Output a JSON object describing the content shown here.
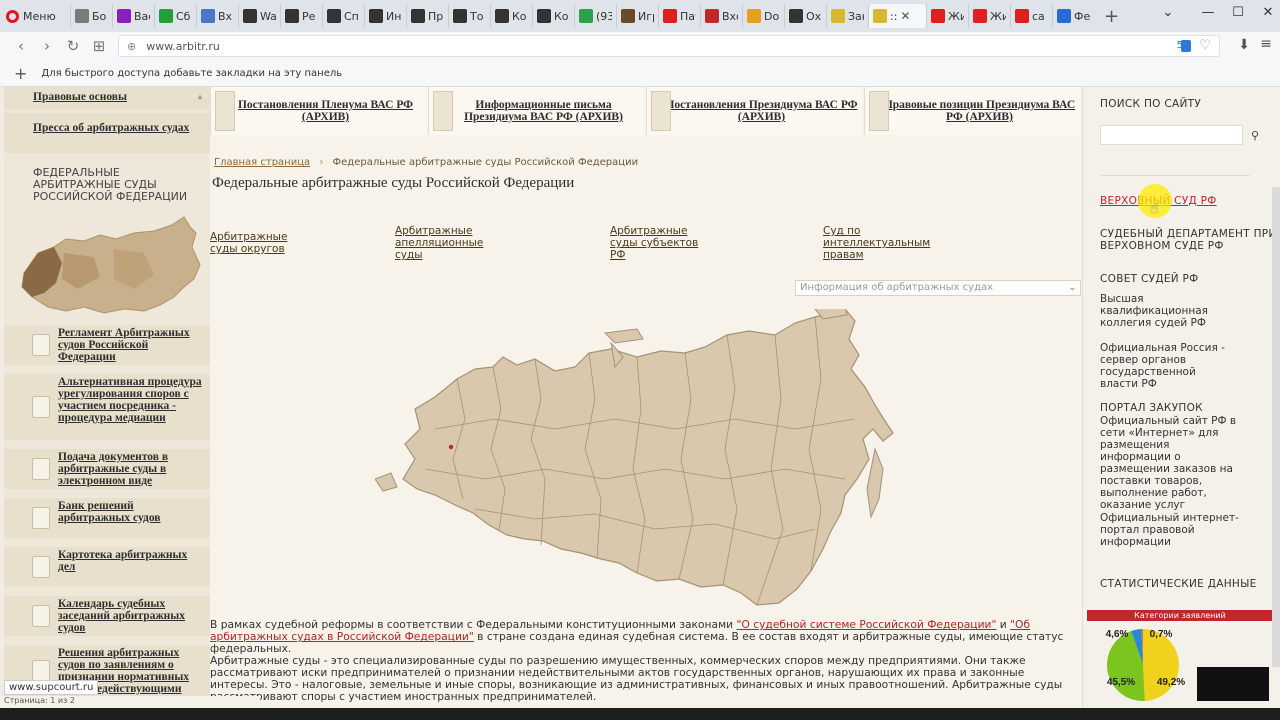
{
  "browser": {
    "menu_label": "Меню",
    "tabs": [
      {
        "label": "Бо",
        "color": "#7a7a7a"
      },
      {
        "label": "Вас",
        "color": "#8b1ebe"
      },
      {
        "label": "Сб",
        "color": "#21a038"
      },
      {
        "label": "Вх",
        "color": "#4a78c8"
      },
      {
        "label": "Wa",
        "color": "#333333"
      },
      {
        "label": "Ре",
        "color": "#333333"
      },
      {
        "label": "Сп",
        "color": "#333333"
      },
      {
        "label": "Ин",
        "color": "#333333"
      },
      {
        "label": "Пр",
        "color": "#333333"
      },
      {
        "label": "То",
        "color": "#333333"
      },
      {
        "label": "Ко",
        "color": "#333333"
      },
      {
        "label": "Ко",
        "color": "#333333"
      },
      {
        "label": "(93",
        "color": "#2aa14b"
      },
      {
        "label": "Игр",
        "color": "#6b4a2a"
      },
      {
        "label": "Пач",
        "color": "#e02020"
      },
      {
        "label": "Вхо",
        "color": "#c0262a"
      },
      {
        "label": "Do",
        "color": "#e8a020"
      },
      {
        "label": "Ох",
        "color": "#333333"
      },
      {
        "label": "Зак",
        "color": "#d8b830"
      }
    ],
    "active_tab": {
      "label": "::",
      "close": "✕",
      "color": "#d8b830"
    },
    "tabs_after": [
      {
        "label": "Жи",
        "color": "#e02020"
      },
      {
        "label": "Жи",
        "color": "#e02020"
      },
      {
        "label": "са",
        "color": "#e02020"
      },
      {
        "label": "Фе",
        "color": "#2a6ad6"
      }
    ],
    "url": "www.arbitr.ru",
    "counter": "5",
    "bookmarks_hint": "Для быстрого доступа добавьте закладки на эту панель"
  },
  "left_nav": {
    "top_items": [
      "Правовые основы",
      "Пресса об арбитражных судах"
    ],
    "fed_label": "ФЕДЕРАЛЬНЫЕ АРБИТРАЖНЫЕ СУДЫ РОССИЙСКОЙ ФЕДЕРАЦИИ",
    "doc_items": [
      "Регламент Арбитражных судов Российской Федерации",
      "Альтернативная процедура урегулирования споров с участием посредника - процедура медиации",
      "Подача документов в арбитражные суды в электронном виде",
      "Банк решений арбитражных судов",
      "Картотека арбитражных дел",
      "Календарь судебных заседаний арбитражных судов",
      "Решения арбитражных судов по заявлениям о признании нормативных актов недействующими"
    ]
  },
  "top_docs": [
    "Постановления Пленума ВАС РФ (АРХИВ)",
    "Информационные письма Президиума ВАС РФ (АРХИВ)",
    "Постановления Президиума ВАС РФ (АРХИВ)",
    "Правовые позиции Президиума ВАС РФ (АРХИВ)"
  ],
  "breadcrumb": {
    "home": "Главная страница",
    "separator": "›",
    "current": "Федеральные арбитражные суды Российской Федерации"
  },
  "page_title": "Федеральные арбитражные суды Российской Федерации",
  "court_links": [
    "Арбитражные суды округов",
    "Арбитражные апелляционные суды",
    "Арбитражные суды субъектов РФ",
    "Суд по интеллектуальным правам"
  ],
  "info_select": {
    "value": "Информация об арбитражных судах",
    "arrow": "⌄"
  },
  "paragraph1": {
    "before": "В рамках судебной реформы в соответствии с Федеральными конституционными законами ",
    "link1": "\"О судебной системе Российской Федерации\"",
    "middle": " и ",
    "link2": "\"Об арбитражных судах в Российской Федерации\"",
    "after": " в стране создана единая судебная система. В ее состав входят и арбитражные суды, имеющие статус федеральных."
  },
  "paragraph2": "Арбитражные суды - это специализированные суды по разрешению имущественных, коммерческих споров между предприятиями. Они также рассматривают иски предпринимателей о признании недействительными актов государственных органов, нарушающих их права и законные интересы. Это - налоговые, земельные и иные споры, возникающие из административных, финансовых и иных правоотношений. Арбитражные суды рассматривают споры с участием иностранных предпринимателей.",
  "right": {
    "search_heading": "ПОИСК ПО САЙТУ",
    "search_icon": "search-icon",
    "supreme_link": "ВЕРХОВНЫЙ СУД РФ",
    "judicial_dept": "СУДЕБНЫЙ ДЕПАРТАМЕНТ ПРИ ВЕРХОВНОМ СУДЕ РФ",
    "council": "СОВЕТ СУДЕЙ РФ",
    "qual_board": "Высшая квалификационная коллегия судей РФ",
    "official_russia": "Официальная Россия - сервер органов государственной власти РФ",
    "procurement_head": "ПОРТАЛ ЗАКУПОК",
    "procurement_text": "Официальный сайт РФ в сети «Интернет» для размещения информации о размещении заказов на поставки товаров, выполнение работ, оказание услуг",
    "legal_portal": "Официальный интернет-портал правовой информации",
    "stats_heading": "СТАТИСТИЧЕСКИЕ ДАННЫЕ",
    "stats_bar": "Категории заявлений"
  },
  "chart_data": {
    "type": "pie",
    "title": "Категории заявлений",
    "slices": [
      {
        "label": "49,2",
        "value": 49.2,
        "color": "#f0d21e"
      },
      {
        "label": "45,5",
        "value": 45.5,
        "color": "#7cc41e"
      },
      {
        "label": "4,6",
        "value": 4.6,
        "color": "#2a88d8"
      },
      {
        "label": "0,7",
        "value": 0.7,
        "color": "#e07820"
      }
    ]
  },
  "status": {
    "url_tooltip": "www.supcourt.ru",
    "status_text": "Страница: 1 из 2"
  }
}
